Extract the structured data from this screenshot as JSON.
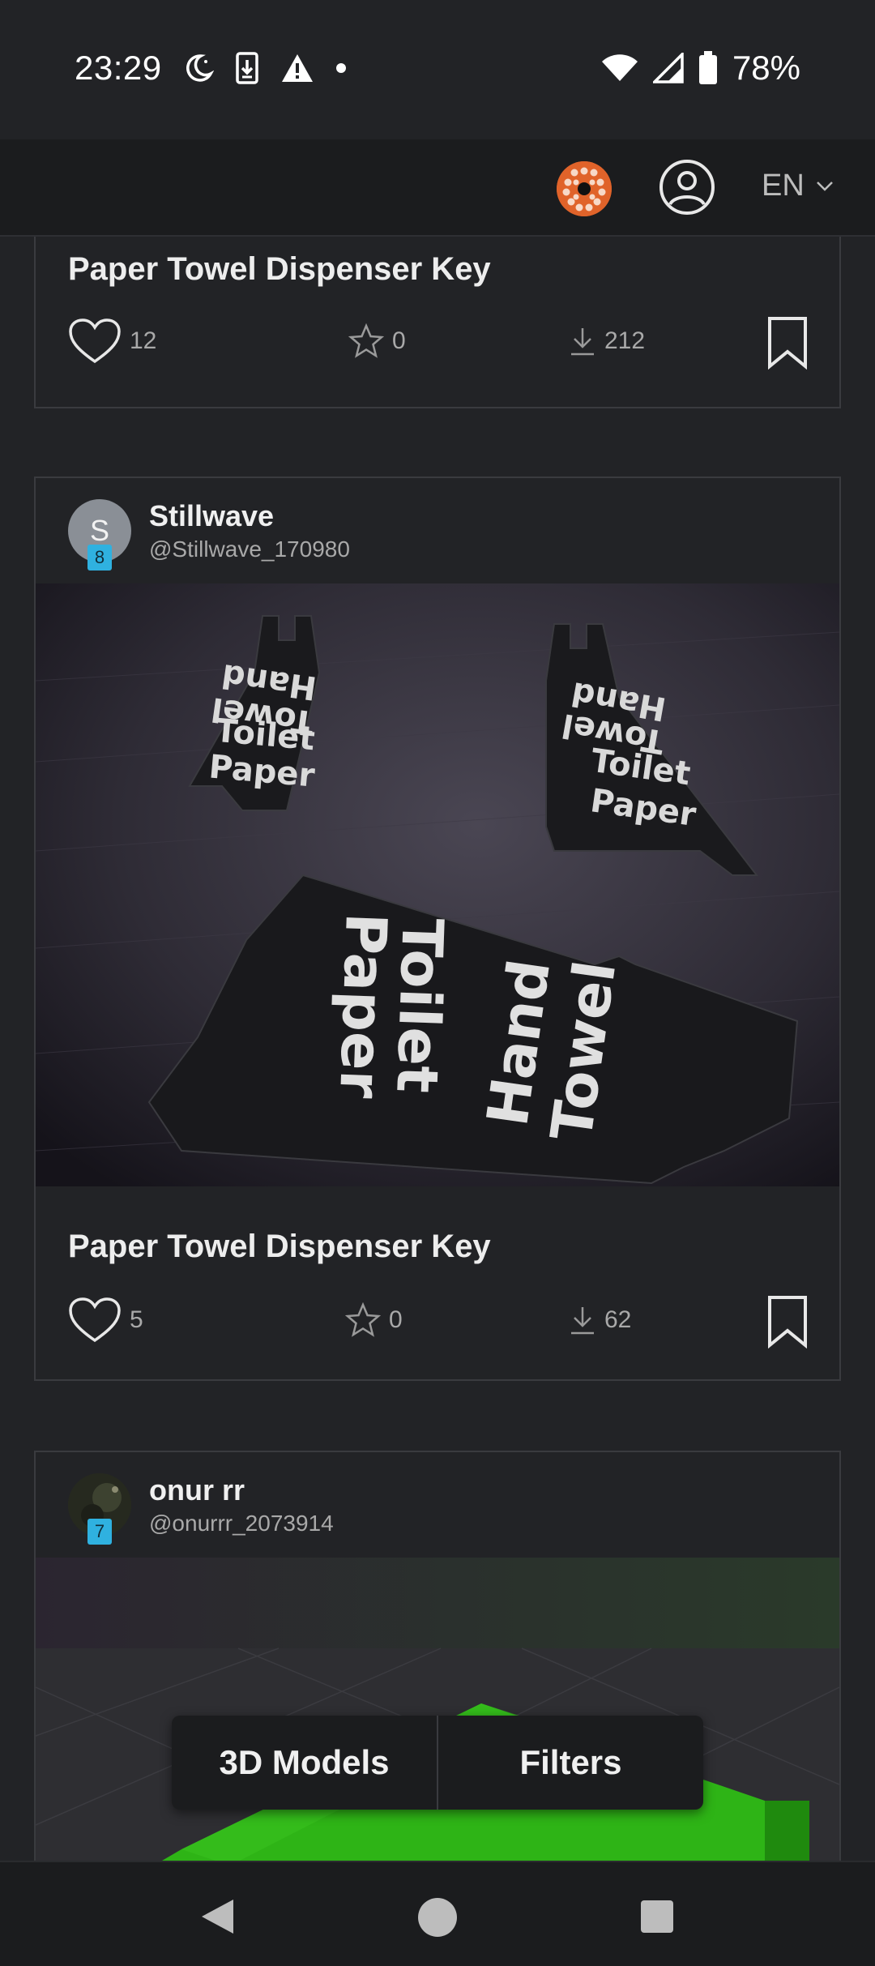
{
  "status_bar": {
    "time": "23:29",
    "battery": "78%",
    "icons_left": [
      "night-mode-icon",
      "download-icon",
      "warning-icon",
      "dot-icon"
    ],
    "icons_right": [
      "wifi-icon",
      "signal-icon",
      "battery-icon"
    ]
  },
  "header": {
    "language": "EN",
    "icons": [
      "logo-icon",
      "account-icon",
      "chevron-down-icon"
    ]
  },
  "cards": [
    {
      "title": "Paper Towel Dispenser Key",
      "likes": "12",
      "stars": "0",
      "downloads": "212"
    },
    {
      "author_initial": "S",
      "author_level": "8",
      "author_name": "Stillwave",
      "author_handle": "@Stillwave_170980",
      "image_text": {
        "left_key": [
          "Hand",
          "Towel",
          "Toilet",
          "Paper"
        ],
        "right_key": [
          "Hand",
          "Towel",
          "Toilet",
          "Paper"
        ],
        "front_key": [
          "Toilet",
          "Paper",
          "Hand",
          "Towel"
        ]
      },
      "title": "Paper Towel Dispenser Key",
      "likes": "5",
      "stars": "0",
      "downloads": "62"
    },
    {
      "author_level": "7",
      "author_name": "onur rr",
      "author_handle": "@onurrr_2073914"
    }
  ],
  "bottom_tabs": {
    "models_label": "3D Models",
    "filters_label": "Filters"
  },
  "navbar": {
    "icons": [
      "back-icon",
      "home-icon",
      "recents-icon"
    ]
  },
  "colors": {
    "background": "#222326",
    "header": "#1b1c1e",
    "badge": "#2fb1e0",
    "logo": "#e0632a",
    "model_green": "#2eb416"
  }
}
